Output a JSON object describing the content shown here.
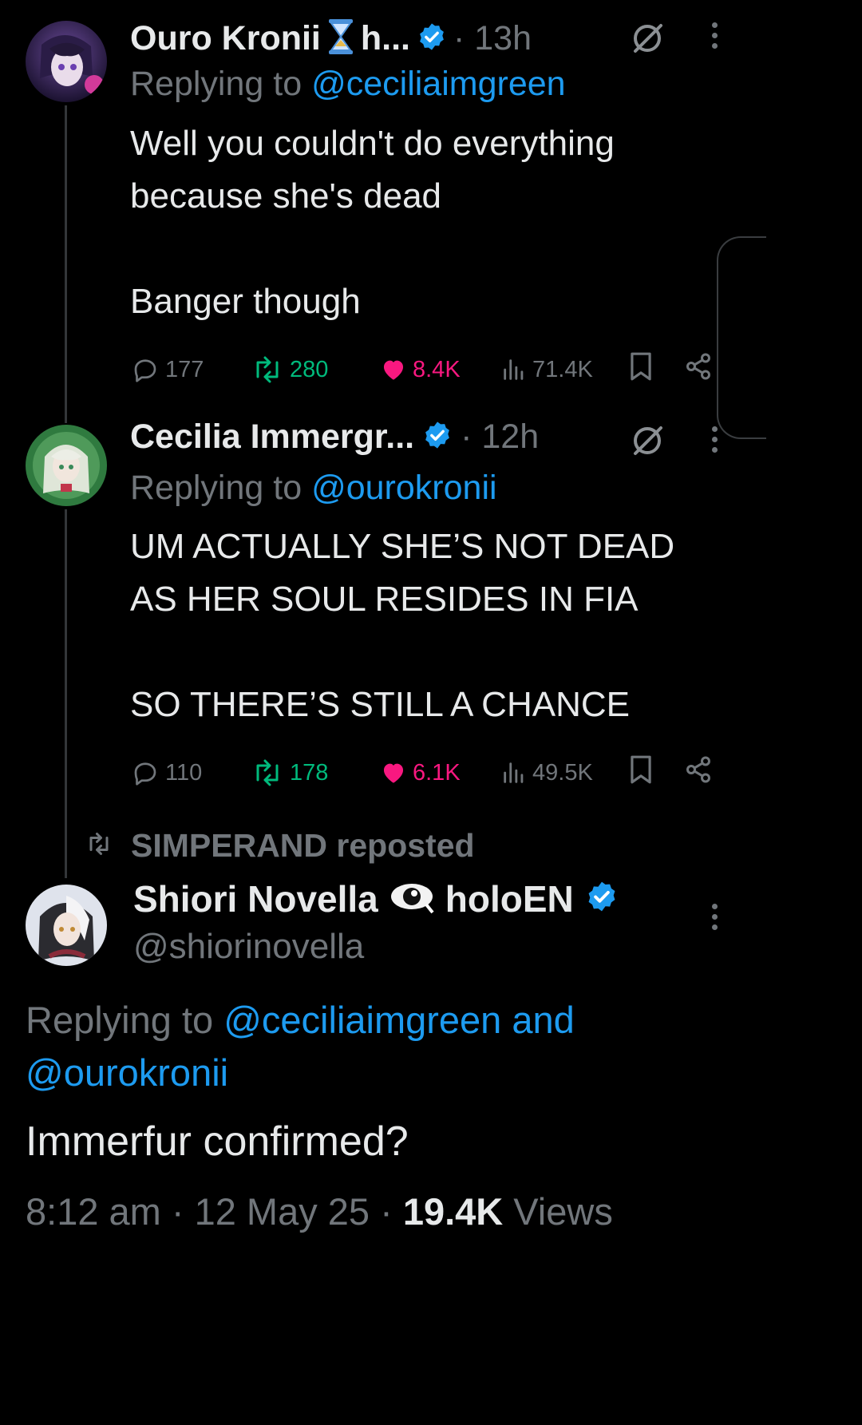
{
  "tweets": [
    {
      "author": "Ouro Kronii",
      "author_suffix": "h...",
      "dot_time": "· 13h",
      "replying_prefix": "Replying to ",
      "replying_handle": "@ceciliaimgreen",
      "body": "Well you couldn't do everything\nbecause she's dead\n\nBanger though",
      "replies": "177",
      "reposts": "280",
      "likes": "8.4K",
      "views": "71.4K"
    },
    {
      "author": "Cecilia Immergr...",
      "dot_time": "· 12h",
      "replying_prefix": "Replying to ",
      "replying_handle": "@ourokronii",
      "body": "UM ACTUALLY SHE’S NOT DEAD\nAS HER SOUL RESIDES IN FIA\n\nSO THERE’S STILL A CHANCE",
      "replies": "110",
      "reposts": "178",
      "likes": "6.1K",
      "views": "49.5K"
    }
  ],
  "main_tweet": {
    "reposted_by": "SIMPERAND reposted",
    "author": "Shiori Novella",
    "author_suffix": "holoEN",
    "handle": "@shiorinovella",
    "replying_prefix": "Replying to ",
    "replying_handles": "@ceciliaimgreen and",
    "replying_handles_2": "@ourokronii",
    "body": "Immerfur confirmed?",
    "timestamp": "8:12 am · 12 May 25 · ",
    "views_count": "19.4K",
    "views_label": " Views"
  },
  "colors": {
    "background": "#000000",
    "text": "#e7e9ea",
    "muted": "#71767b",
    "accent": "#1d9bf0",
    "repost_green": "#00ba7c",
    "like_pink": "#f91880"
  },
  "icons": [
    "verified-badge-icon",
    "hourglass-icon",
    "grok-icon",
    "more-icon",
    "reply-icon",
    "repost-icon",
    "like-icon",
    "views-icon",
    "bookmark-icon",
    "share-icon",
    "eye-emoji-icon"
  ]
}
